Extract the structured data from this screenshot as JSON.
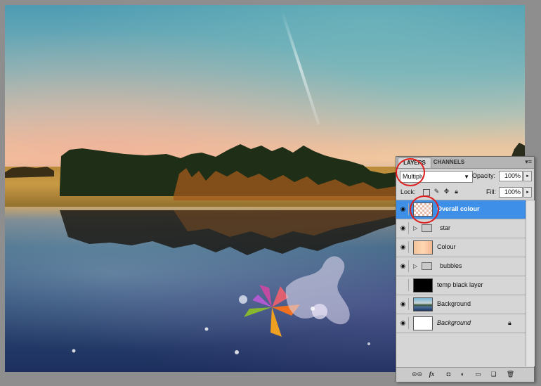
{
  "panel": {
    "tabs": {
      "layers": "LAYERS",
      "channels": "CHANNELS"
    },
    "menu_icon": "panel-menu-icon",
    "blend_mode": "Multiply",
    "opacity_label": "Opacity:",
    "opacity_value": "100%",
    "lock_label": "Lock:",
    "fill_label": "Fill:",
    "fill_value": "100%"
  },
  "layers": [
    {
      "name": "Overall colour",
      "visible": true,
      "selected": true,
      "thumb": "checker"
    },
    {
      "name": "star",
      "visible": true,
      "type": "group"
    },
    {
      "name": "Colour",
      "visible": true,
      "thumb": "colour"
    },
    {
      "name": "bubbles",
      "visible": true,
      "type": "group"
    },
    {
      "name": "temp black layer",
      "visible": false,
      "thumb": "black"
    },
    {
      "name": "Background",
      "visible": true,
      "thumb": "photo"
    },
    {
      "name": "Background",
      "visible": true,
      "thumb": "white",
      "italic": true,
      "locked": true
    }
  ],
  "footer_icons": [
    "link-layers-icon",
    "fx-icon",
    "layer-mask-icon",
    "adjustment-layer-icon",
    "new-group-icon",
    "new-layer-icon",
    "delete-layer-icon"
  ],
  "annotation_color": "#e01d1d",
  "selection_color": "#3d8fe8"
}
